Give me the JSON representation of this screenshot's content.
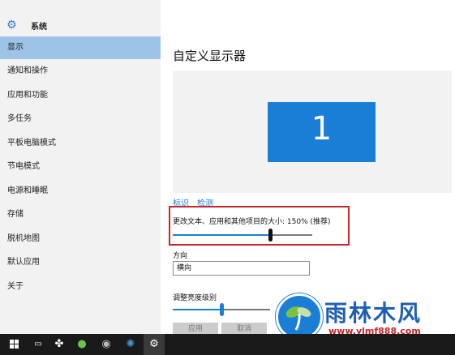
{
  "window": {
    "title": "设置"
  },
  "sidebar": {
    "section_title": "系统",
    "items": [
      {
        "label": "显示",
        "active": true
      },
      {
        "label": "通知和操作"
      },
      {
        "label": "应用和功能"
      },
      {
        "label": "多任务"
      },
      {
        "label": "平板电脑模式"
      },
      {
        "label": "节电模式"
      },
      {
        "label": "电源和睡眠"
      },
      {
        "label": "存储"
      },
      {
        "label": "脱机地图"
      },
      {
        "label": "默认应用"
      },
      {
        "label": "关于"
      }
    ]
  },
  "main": {
    "title": "自定义显示器",
    "monitor_number": "1",
    "identify_link": "标识",
    "detect_link": "检测",
    "scale_label": "更改文本、应用和其他项目的大小: 150% (推荐)",
    "scale_level": 0.7,
    "orientation_label": "方向",
    "orientation_value": "横向",
    "brightness_label": "调整亮度级别",
    "brightness_level": 0.5,
    "apply_button": "应用",
    "cancel_button": "取消"
  },
  "watermark": {
    "name": "雨林木风",
    "url": "www.ylmf888.com"
  },
  "colors": {
    "accent": "#1b7ed6",
    "highlight_box": "#c8252c",
    "nav_active": "#9dc3e6"
  }
}
